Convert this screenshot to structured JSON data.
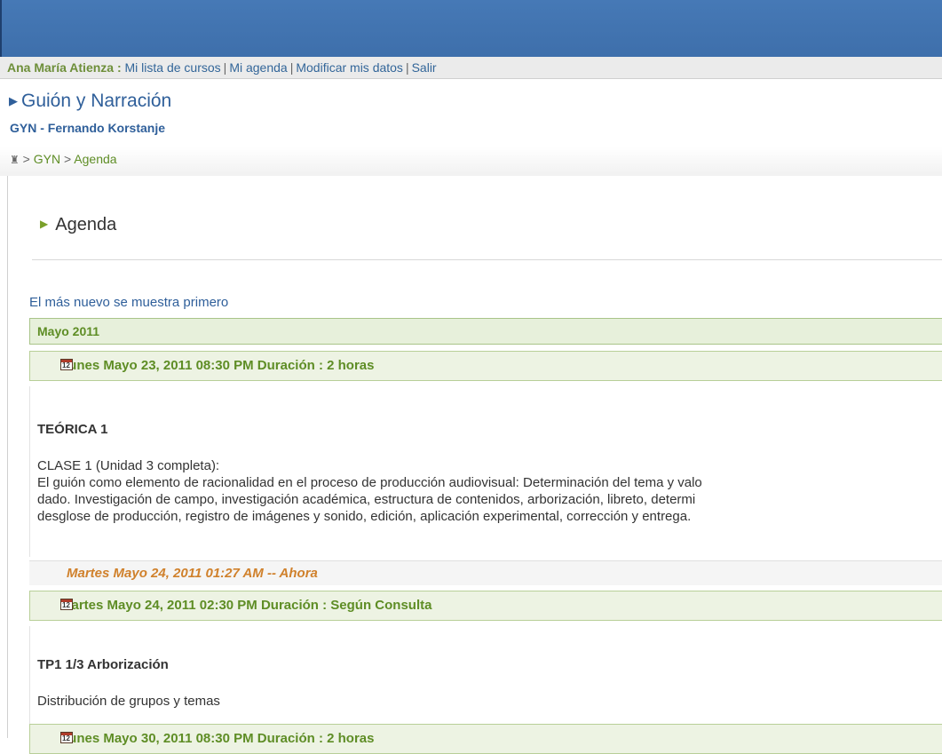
{
  "header": {
    "user_name": "Ana María Atienza :",
    "links": [
      "Mi lista de cursos",
      "Mi agenda",
      "Modificar mis datos",
      "Salir"
    ]
  },
  "course": {
    "title": "Guión y Narración",
    "subtitle": "GYN - Fernando Korstanje",
    "breadcrumb": [
      ">",
      "GYN",
      ">",
      "Agenda"
    ]
  },
  "agenda": {
    "heading": "Agenda",
    "order_note": "El más nuevo se muestra primero",
    "month": "Mayo 2011",
    "events": [
      {
        "header": "Lunes Mayo 23, 2011 08:30 PM Duración : 2 horas",
        "title": "TEÓRICA 1",
        "lines": [
          "CLASE 1 (Unidad 3 completa):",
          "El guión como elemento de racionalidad en el proceso de producción audiovisual: Determinación del tema y valo",
          "dado. Investigación de campo, investigación académica, estructura de contenidos, arborización, libreto, determi",
          "desglose de producción, registro de imágenes y sonido, edición, aplicación experimental, corrección y entrega."
        ]
      },
      {
        "header": "Martes Mayo 24, 2011 02:30 PM Duración : Según Consulta",
        "title": "TP1 1/3 Arborización",
        "lines": [
          "Distribución de grupos y temas"
        ]
      },
      {
        "header": "Lunes Mayo 30, 2011 08:30 PM Duración : 2 horas"
      }
    ],
    "now_marker": "Martes Mayo 24, 2011 01:27 AM -- Ahora"
  },
  "colors": {
    "topbar": "#4679b6",
    "link_blue": "#336699",
    "green": "#5e8d25",
    "now_orange": "#d0812c"
  }
}
